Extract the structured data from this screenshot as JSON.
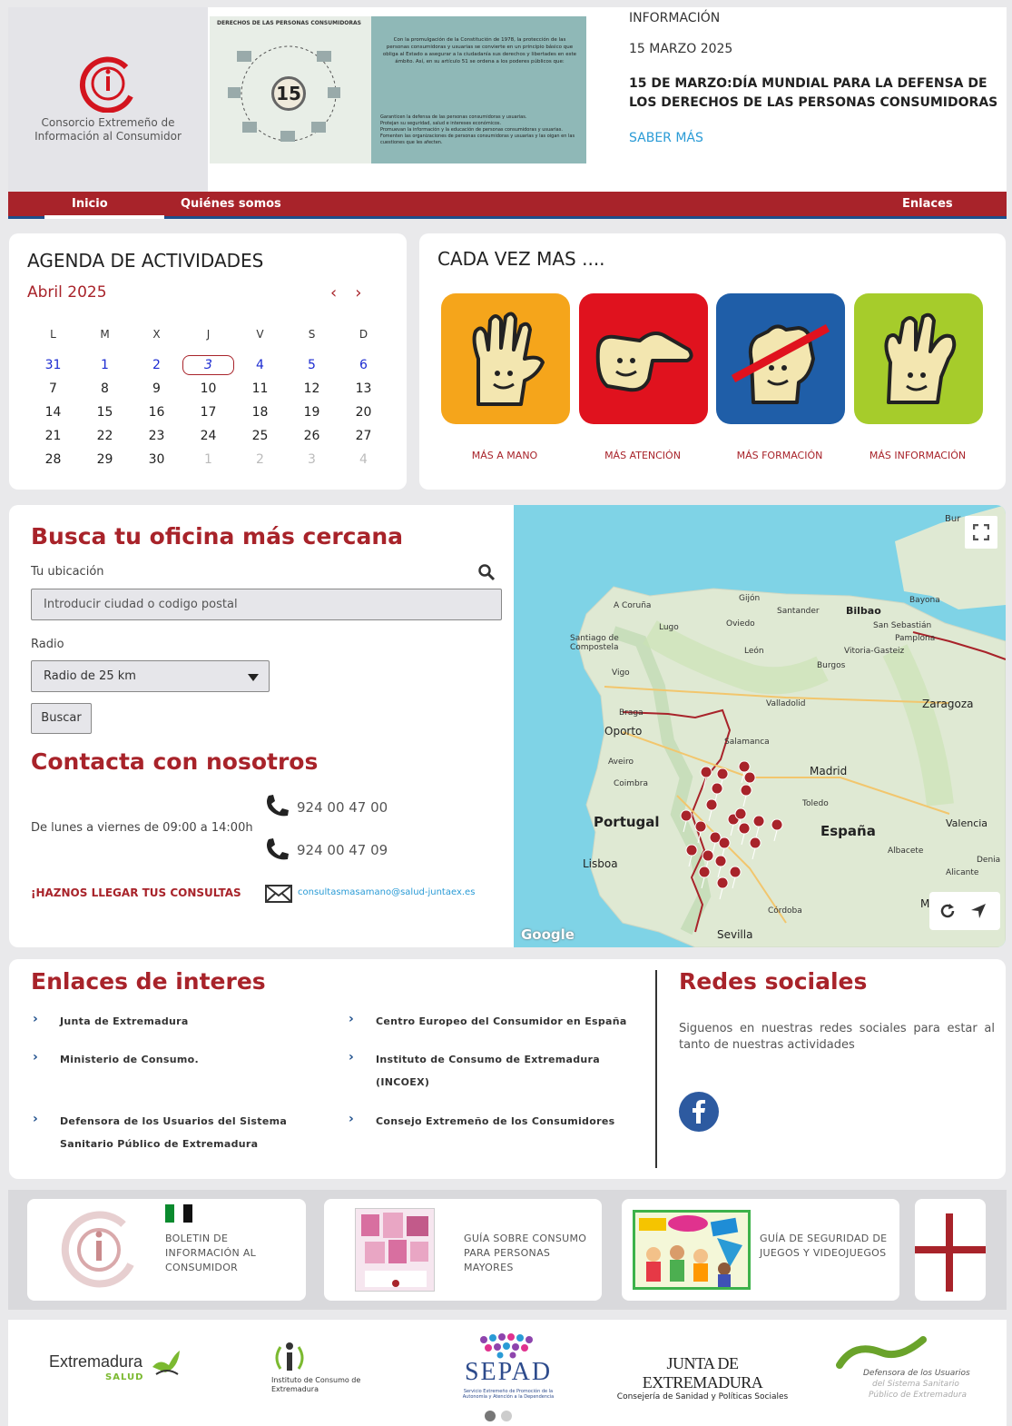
{
  "header": {
    "logo_text": "Consorcio Extremeño de Información al Consumidor",
    "banner": {
      "title": "DERECHOS DE LAS PERSONAS CONSUMIDORAS",
      "number": "15",
      "body": "Con la promulgación de la Constitución de 1978, la protección de las personas consumidoras y usuarias se convierte en un principio básico que obliga al Estado a asegurar a la ciudadanía sus derechos y libertades en este ámbito. Así, en su artículo 51 se ordena a los poderes públicos que:",
      "bullets": [
        "Garanticen la defensa de las personas consumidoras y usuarias.",
        "Protejan su seguridad, salud e intereses económicos.",
        "Promuevan la información y la educación de personas consumidoras y usuarias.",
        "Fomenten las organizaciones de personas consumidoras y usuarias y las oigan en las cuestiones que les afecten."
      ]
    },
    "news": {
      "category": "INFORMACIÓN",
      "date": "15 MARZO 2025",
      "headline": "15 DE MARZO:DÍA MUNDIAL PARA LA DEFENSA DE LOS DERECHOS DE LAS PERSONAS CONSUMIDORAS",
      "more": "SABER MÁS"
    }
  },
  "nav": {
    "inicio": "Inicio",
    "quienes": "Quiénes somos",
    "enlaces": "Enlaces"
  },
  "agenda": {
    "title": "AGENDA DE ACTIVIDADES",
    "month": "Abril 2025",
    "prev": "‹",
    "next": "›",
    "weekdays": [
      "L",
      "M",
      "X",
      "J",
      "V",
      "S",
      "D"
    ],
    "weeks": [
      [
        "31",
        "1",
        "2",
        "3",
        "4",
        "5",
        "6"
      ],
      [
        "7",
        "8",
        "9",
        "10",
        "11",
        "12",
        "13"
      ],
      [
        "14",
        "15",
        "16",
        "17",
        "18",
        "19",
        "20"
      ],
      [
        "21",
        "22",
        "23",
        "24",
        "25",
        "26",
        "27"
      ],
      [
        "28",
        "29",
        "30",
        "1",
        "2",
        "3",
        "4"
      ]
    ]
  },
  "mas": {
    "title": "CADA VEZ MAS ....",
    "items": [
      {
        "label": "MÁS A MANO",
        "color": "#f5a51b"
      },
      {
        "label": "MÁS ATENCIÓN",
        "color": "#e0121e"
      },
      {
        "label": "MÁS FORMACIÓN",
        "color": "#1f5ea8"
      },
      {
        "label": "MÁS INFORMACIÓN",
        "color": "#a6cc2b"
      }
    ]
  },
  "office": {
    "title": "Busca tu oficina más cercana",
    "location_label": "Tu ubicación",
    "location_placeholder": "Introducir ciudad o codigo postal",
    "radius_label": "Radio",
    "radius_value": "Radio de 25 km",
    "search_button": "Buscar",
    "contact_title": "Contacta con nosotros",
    "hours": "De lunes a viernes de 09:00 a 14:00h",
    "phone1": "924 00 47 00",
    "phone2": "924 00 47 09",
    "consult_label": "¡HAZNOS LLEGAR TUS CONSULTAS",
    "email": "consultasmasamano@salud-juntaex.es"
  },
  "map": {
    "labels": {
      "bur": "Bur",
      "coruna": "A Coruña",
      "gijon": "Gijón",
      "santander": "Santander",
      "bilbao": "Bilbao",
      "bayona": "Bayona",
      "lugo": "Lugo",
      "oviedo": "Oviedo",
      "sansebastian": "San Sebastián",
      "pamplona": "Pamplona",
      "santiago": "Santiago de Compostela",
      "leon": "León",
      "vitoria": "Vitoria-Gasteiz",
      "burgos": "Burgos",
      "vigo": "Vigo",
      "braga": "Braga",
      "valladolid": "Valladolid",
      "zaragoza": "Zaragoza",
      "oporto": "Oporto",
      "salamanca": "Salamanca",
      "aveiro": "Aveiro",
      "madrid": "Madrid",
      "coimbra": "Coimbra",
      "toledo": "Toledo",
      "portugal": "Portugal",
      "espana": "España",
      "valencia": "Valencia",
      "lisboa": "Lisboa",
      "albacete": "Albacete",
      "alicante": "Alicante",
      "denia": "Denia",
      "cordoba": "Córdoba",
      "sevilla": "Sevilla",
      "m": "M",
      "google": "Google"
    }
  },
  "links": {
    "title": "Enlaces de interes",
    "items": [
      "Junta de Extremadura",
      "Centro Europeo del Consumidor en España",
      "Ministerio de Consumo.",
      "Instituto de Consumo de Extremadura (INCOEX)",
      "Defensora de los Usuarios del Sistema Sanitario Público de Extremadura",
      "Consejo Extremeño de los Consumidores"
    ],
    "social_title": "Redes sociales",
    "social_text": "Siguenos en nuestras redes sociales para estar al tanto de nuestras actividades"
  },
  "promos": [
    "BOLETIN DE INFORMACIÓN AL CONSUMIDOR",
    "GUÍA SOBRE CONSUMO PARA PERSONAS MAYORES",
    "GUÍA DE SEGURIDAD DE JUEGOS Y VIDEOJUEGOS"
  ],
  "footer": {
    "extremadura": "Extremadura",
    "salud": "SALUD",
    "incoex": "Instituto de Consumo de Extremadura",
    "sepad": "SEPAD",
    "sepad_sub": "Servicio Extremeño de Promoción de la Autonomía y Atención a la Dependencia",
    "junta": "JUNTA DE EXTREMADURA",
    "junta_sub": "Consejería de Sanidad y Políticas Sociales",
    "defensora1": "Defensora de los Usuarios",
    "defensora2": "del Sistema Sanitario",
    "defensora3": "Público de Extremadura"
  }
}
